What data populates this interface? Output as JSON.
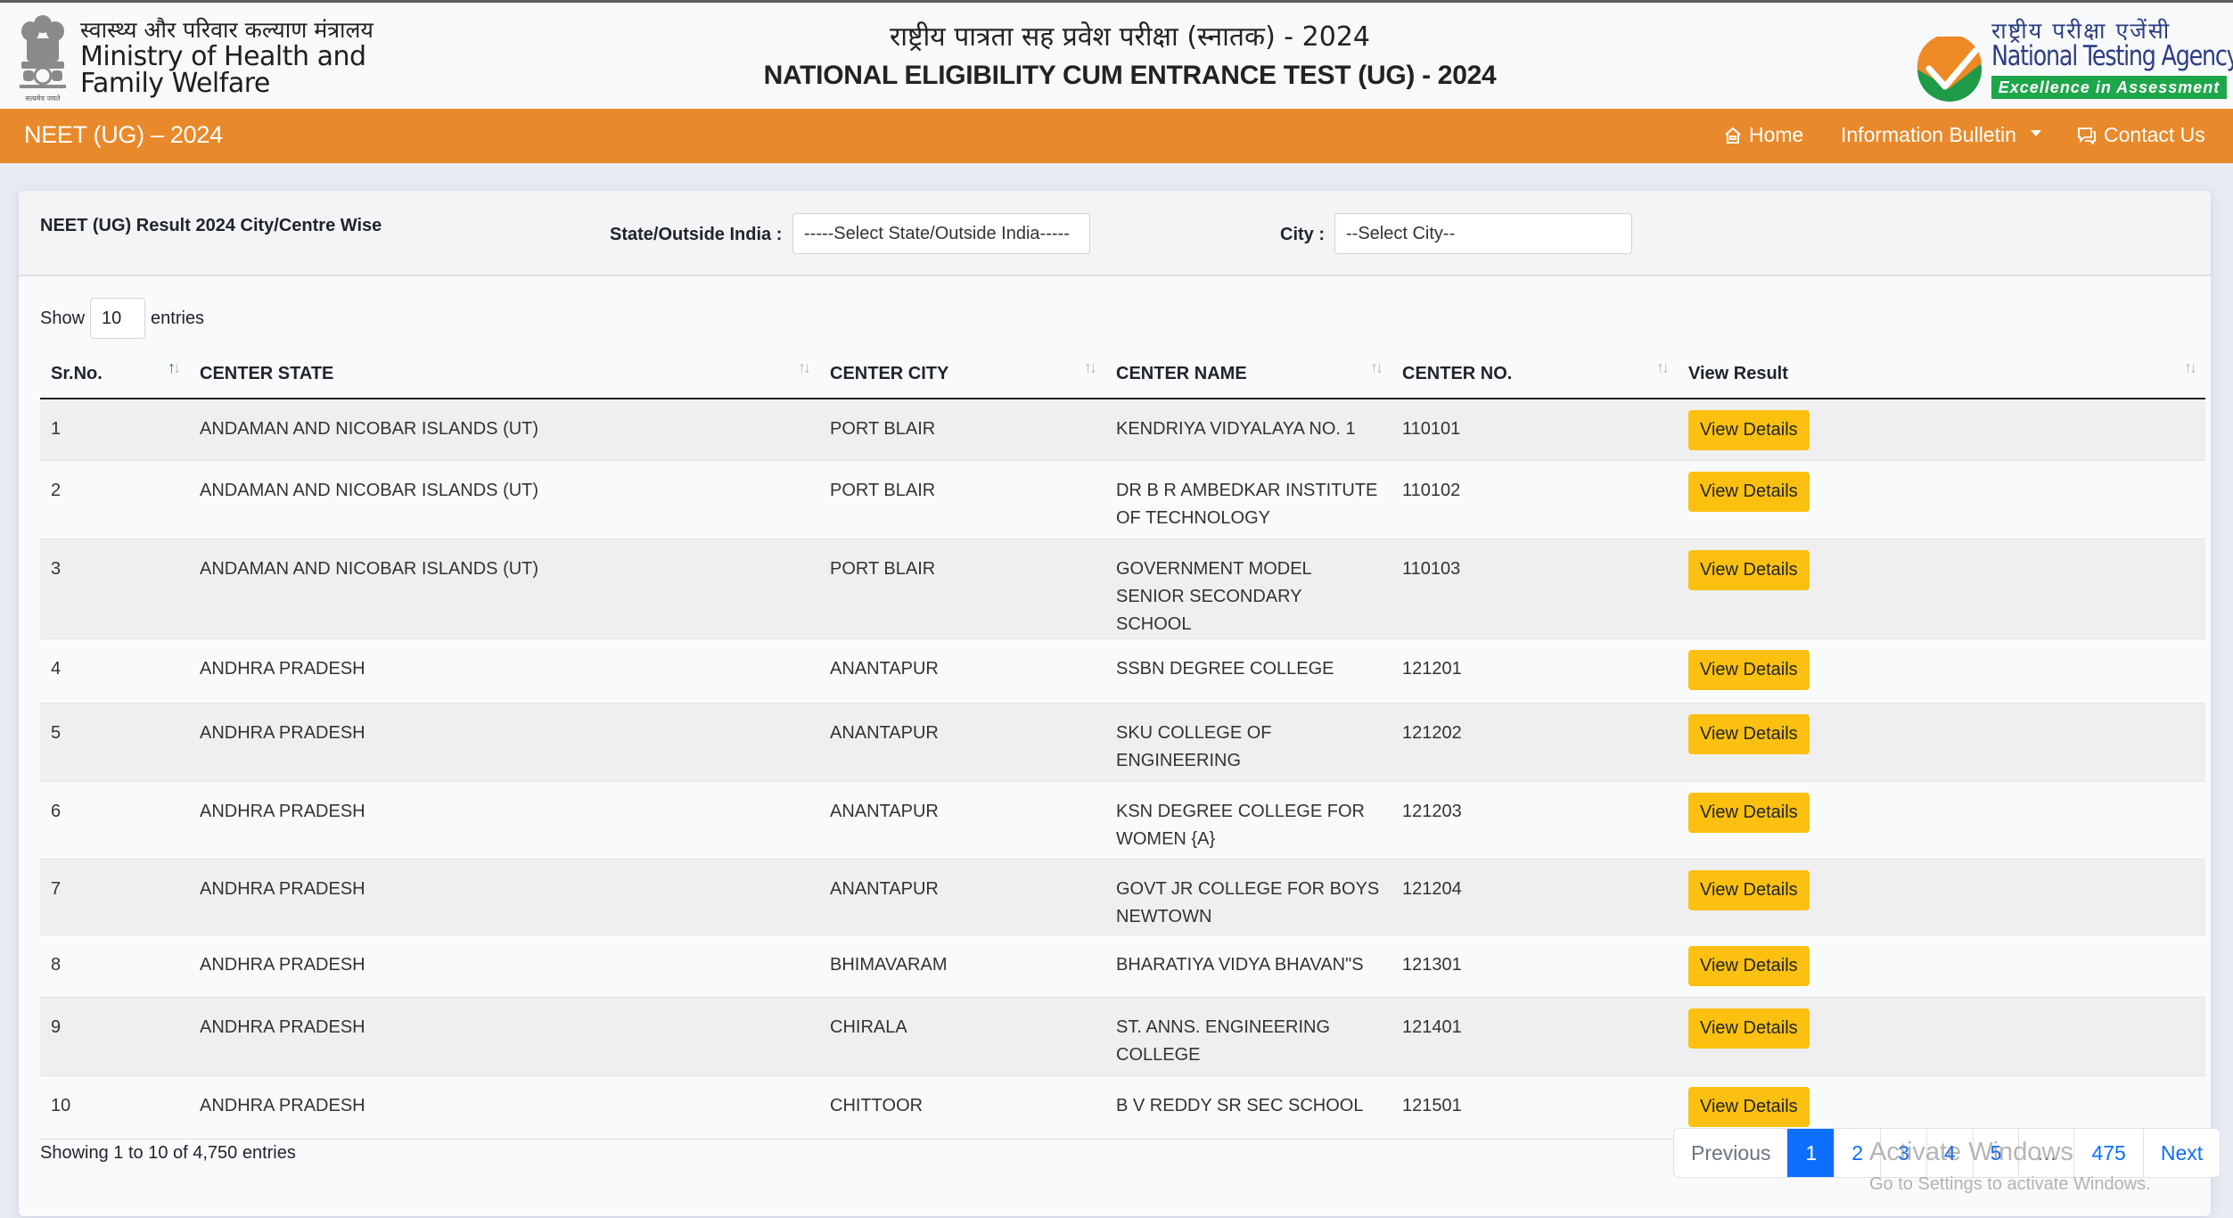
{
  "header": {
    "ministry_hindi": "स्वास्थ्य और परिवार कल्याण मंत्रालय",
    "ministry_line1": "Ministry of Health and",
    "ministry_line2": "Family Welfare",
    "emblem_motto": "सत्यमेव जयते",
    "title_hindi": "राष्ट्रीय पात्रता सह प्रवेश परीक्षा (स्नातक) - 2024",
    "title_english": "NATIONAL ELIGIBILITY CUM ENTRANCE TEST (UG) - 2024",
    "nta_hindi": "राष्ट्रीय परीक्षा एजेंसी",
    "nta_english": "National Testing Agency",
    "nta_tagline": "Excellence in Assessment"
  },
  "navbar": {
    "brand": "NEET (UG) – 2024",
    "home": "Home",
    "bulletin": "Information Bulletin",
    "contact": "Contact Us",
    "color": "#e8892b"
  },
  "filters": {
    "title": "NEET (UG) Result 2024 City/Centre Wise",
    "state_label": "State/Outside India :",
    "state_value": "-----Select State/Outside India-----",
    "city_label": "City :",
    "city_value": "--Select City--"
  },
  "length": {
    "show": "Show",
    "value": "10",
    "entries": "entries"
  },
  "table": {
    "columns": [
      "Sr.No.",
      "CENTER STATE",
      "CENTER CITY",
      "CENTER NAME",
      "CENTER NO.",
      "View Result"
    ],
    "button_label": "View Details",
    "rows": [
      {
        "sr": "1",
        "state": "ANDAMAN AND NICOBAR ISLANDS (UT)",
        "city": "PORT BLAIR",
        "name": "KENDRIYA VIDYALAYA NO. 1",
        "no": "110101"
      },
      {
        "sr": "2",
        "state": "ANDAMAN AND NICOBAR ISLANDS (UT)",
        "city": "PORT BLAIR",
        "name": "DR B R AMBEDKAR INSTITUTE OF TECHNOLOGY",
        "no": "110102"
      },
      {
        "sr": "3",
        "state": "ANDAMAN AND NICOBAR ISLANDS (UT)",
        "city": "PORT BLAIR",
        "name": "GOVERNMENT MODEL SENIOR SECONDARY SCHOOL",
        "no": "110103"
      },
      {
        "sr": "4",
        "state": "ANDHRA PRADESH",
        "city": "ANANTAPUR",
        "name": "SSBN DEGREE COLLEGE",
        "no": "121201"
      },
      {
        "sr": "5",
        "state": "ANDHRA PRADESH",
        "city": "ANANTAPUR",
        "name": "SKU COLLEGE OF ENGINEERING",
        "no": "121202"
      },
      {
        "sr": "6",
        "state": "ANDHRA PRADESH",
        "city": "ANANTAPUR",
        "name": "KSN DEGREE COLLEGE FOR WOMEN {A}",
        "no": "121203"
      },
      {
        "sr": "7",
        "state": "ANDHRA PRADESH",
        "city": "ANANTAPUR",
        "name": "GOVT JR COLLEGE FOR BOYS NEWTOWN",
        "no": "121204"
      },
      {
        "sr": "8",
        "state": "ANDHRA PRADESH",
        "city": "BHIMAVARAM",
        "name": "BHARATIYA VIDYA BHAVAN\"S",
        "no": "121301"
      },
      {
        "sr": "9",
        "state": "ANDHRA PRADESH",
        "city": "CHIRALA",
        "name": "ST. ANNS. ENGINEERING COLLEGE",
        "no": "121401"
      },
      {
        "sr": "10",
        "state": "ANDHRA PRADESH",
        "city": "CHITTOOR",
        "name": "B V REDDY SR SEC SCHOOL",
        "no": "121501"
      }
    ]
  },
  "footer": {
    "info": "Showing 1 to 10 of 4,750 entries",
    "pagination": [
      "Previous",
      "1",
      "2",
      "3",
      "4",
      "5",
      "…",
      "475",
      "Next"
    ],
    "active_page": "1"
  },
  "watermark": {
    "line1": "Activate Windows",
    "line2": "Go to Settings to activate Windows."
  }
}
